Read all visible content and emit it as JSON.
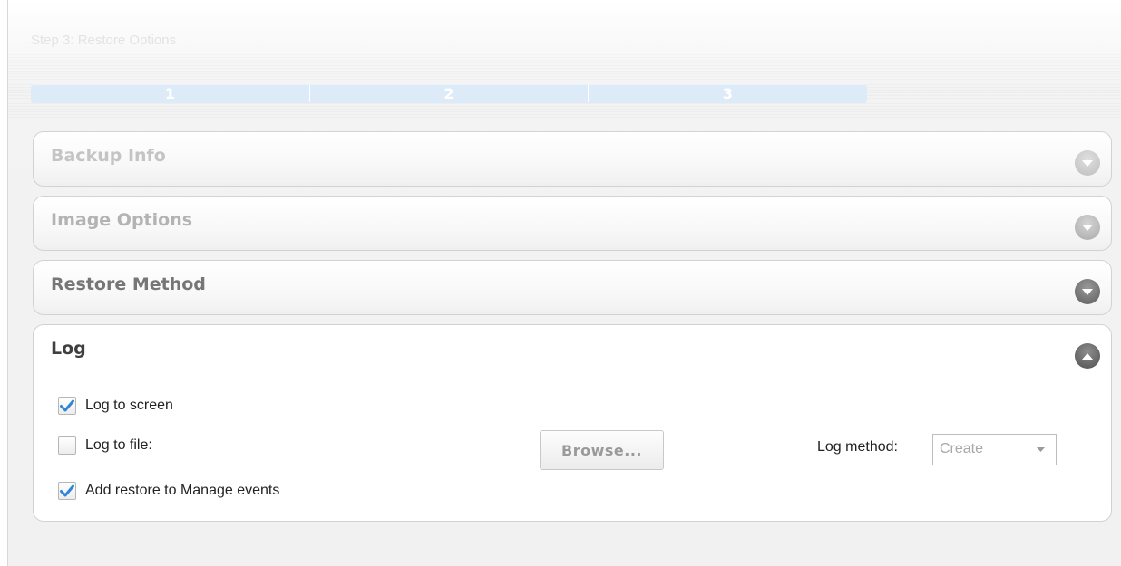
{
  "wizard": {
    "step_title": "Step 3: Restore Options",
    "steps": [
      "1",
      "2",
      "3"
    ],
    "current_step": 3
  },
  "panels": {
    "backup_info": {
      "title": "Backup Info",
      "expanded": false
    },
    "image_options": {
      "title": "Image Options",
      "expanded": false
    },
    "restore_method": {
      "title": "Restore Method",
      "expanded": false
    },
    "log": {
      "title": "Log",
      "expanded": true
    }
  },
  "log": {
    "log_to_screen": {
      "label": "Log to screen",
      "checked": true
    },
    "log_to_file": {
      "label": "Log to file:",
      "checked": false
    },
    "add_restore": {
      "label": "Add restore to Manage events",
      "checked": true
    },
    "browse_label": "Browse...",
    "log_method_label": "Log method:",
    "log_method_value": "Create"
  },
  "icons": {
    "collapse_toggle": "chevron-down-icon",
    "expand_toggle": "chevron-up-icon",
    "checkbox_checked": "checkmark-icon"
  },
  "colors": {
    "progress_bar": "#dcebf7",
    "check_accent": "#2f86d9",
    "toggle_faded": "#c7c7c7",
    "toggle_active": "#6b6b6b"
  }
}
